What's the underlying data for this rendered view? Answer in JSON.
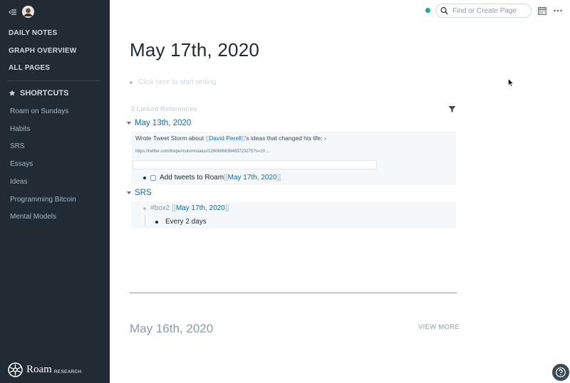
{
  "sidebar": {
    "nav": [
      {
        "label": "DAILY NOTES"
      },
      {
        "label": "GRAPH OVERVIEW"
      },
      {
        "label": "ALL PAGES"
      }
    ],
    "shortcuts_title": "SHORTCUTS",
    "shortcuts": [
      {
        "label": "Roam on Sundays"
      },
      {
        "label": "Habits"
      },
      {
        "label": "SRS"
      },
      {
        "label": "Essays"
      },
      {
        "label": "Ideas"
      },
      {
        "label": "Programming Bitcoin"
      },
      {
        "label": "Mental Models"
      }
    ],
    "logo": {
      "word": "Roam",
      "sub": "RESEARCH"
    }
  },
  "topbar": {
    "search_placeholder": "Find or Create Page",
    "status_color": "#15b371"
  },
  "page": {
    "title": "May 17th, 2020",
    "placeholder": "Click here to start writing",
    "linked_count": "2 Linked References",
    "refs": [
      {
        "title": "May 13th, 2020",
        "tweet_prefix": "Wrote Tweet Storm about ",
        "tweet_link": "David Perell",
        "tweet_suffix": "'s ideas that changed his life: ›",
        "url": "https://twitter.com/thepericulum/status/1260686836483723275?s=20 ...",
        "todo_text": "Add tweets to Roam ",
        "todo_link": "May 17th, 2020"
      },
      {
        "title": "SRS",
        "tag": "#box2",
        "tag_link": "May 17th, 2020",
        "child": "Every 2 days"
      }
    ],
    "brackets": {
      "open": "[[",
      "close": "]]"
    },
    "next_title": "May 16th, 2020",
    "view_more": "VIEW MORE"
  },
  "colors": {
    "sidebar_bg": "#202b33",
    "link": "#106ba3",
    "ref_bg": "#f5f8fa"
  }
}
